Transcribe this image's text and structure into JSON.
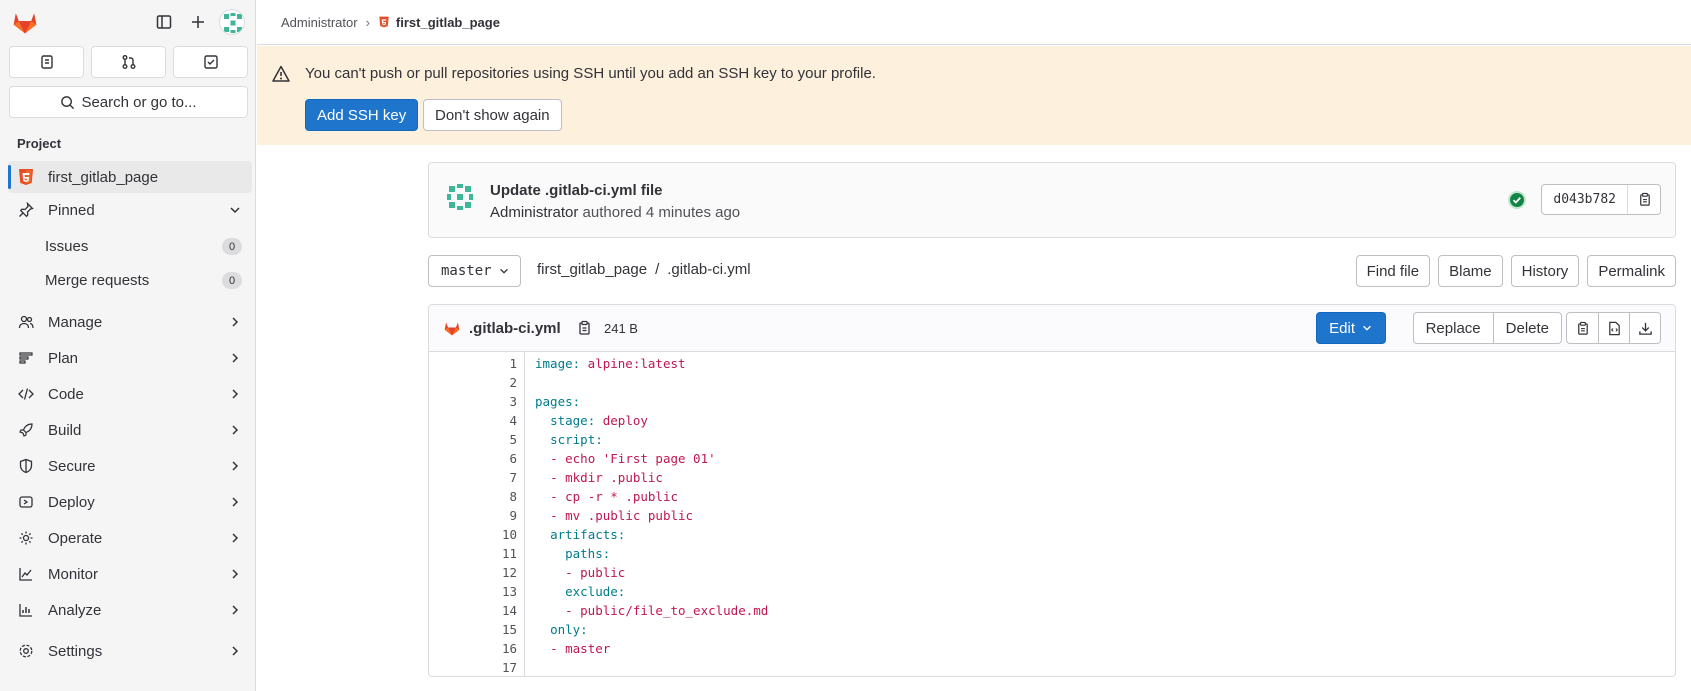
{
  "sidebar": {
    "search_label": "Search or go to...",
    "section_label": "Project",
    "project_name": "first_gitlab_page",
    "pinned_label": "Pinned",
    "pinned_items": [
      {
        "label": "Issues",
        "count": "0"
      },
      {
        "label": "Merge requests",
        "count": "0"
      }
    ],
    "menu": [
      "Manage",
      "Plan",
      "Code",
      "Build",
      "Secure",
      "Deploy",
      "Operate",
      "Monitor",
      "Analyze"
    ],
    "settings_label": "Settings"
  },
  "breadcrumb": {
    "root": "Administrator",
    "current": "first_gitlab_page"
  },
  "alert": {
    "message": "You can't push or pull repositories using SSH until you add an SSH key to your profile.",
    "primary_button": "Add SSH key",
    "secondary_button": "Don't show again"
  },
  "commit": {
    "title": "Update .gitlab-ci.yml file",
    "author": "Administrator",
    "action": "authored",
    "time": "4 minutes ago",
    "sha": "d043b782",
    "pipeline_status": "passed"
  },
  "repo_nav": {
    "branch": "master",
    "path_root": "first_gitlab_page",
    "path_sep": "/",
    "path_file": ".gitlab-ci.yml",
    "buttons": {
      "find_file": "Find file",
      "blame": "Blame",
      "history": "History",
      "permalink": "Permalink"
    }
  },
  "file": {
    "name": ".gitlab-ci.yml",
    "size": "241 B",
    "edit_label": "Edit",
    "replace_label": "Replace",
    "delete_label": "Delete",
    "lines": [
      {
        "n": "1",
        "key": "image:",
        "val": " alpine:latest",
        "indent": ""
      },
      {
        "n": "2",
        "key": "",
        "val": "",
        "indent": ""
      },
      {
        "n": "3",
        "key": "pages:",
        "val": "",
        "indent": ""
      },
      {
        "n": "4",
        "key": "stage:",
        "val": " deploy",
        "indent": "  "
      },
      {
        "n": "5",
        "key": "script:",
        "val": "",
        "indent": "  "
      },
      {
        "n": "6",
        "key": "",
        "val": "- echo 'First page 01'",
        "indent": "  "
      },
      {
        "n": "7",
        "key": "",
        "val": "- mkdir .public",
        "indent": "  "
      },
      {
        "n": "8",
        "key": "",
        "val": "- cp -r * .public",
        "indent": "  "
      },
      {
        "n": "9",
        "key": "",
        "val": "- mv .public public",
        "indent": "  "
      },
      {
        "n": "10",
        "key": "artifacts:",
        "val": "",
        "indent": "  "
      },
      {
        "n": "11",
        "key": "paths:",
        "val": "",
        "indent": "    "
      },
      {
        "n": "12",
        "key": "",
        "val": "- public",
        "indent": "    "
      },
      {
        "n": "13",
        "key": "exclude:",
        "val": "",
        "indent": "    "
      },
      {
        "n": "14",
        "key": "",
        "val": "- public/file_to_exclude.md",
        "indent": "    "
      },
      {
        "n": "15",
        "key": "only:",
        "val": "",
        "indent": "  "
      },
      {
        "n": "16",
        "key": "",
        "val": "- master",
        "indent": "  "
      },
      {
        "n": "17",
        "key": "",
        "val": "",
        "indent": ""
      }
    ]
  },
  "colors": {
    "accent": "#1f75cb",
    "alert_bg": "#fdf1dd",
    "yaml_key": "#007c8b",
    "yaml_value": "#c0174f",
    "success": "#108548"
  }
}
